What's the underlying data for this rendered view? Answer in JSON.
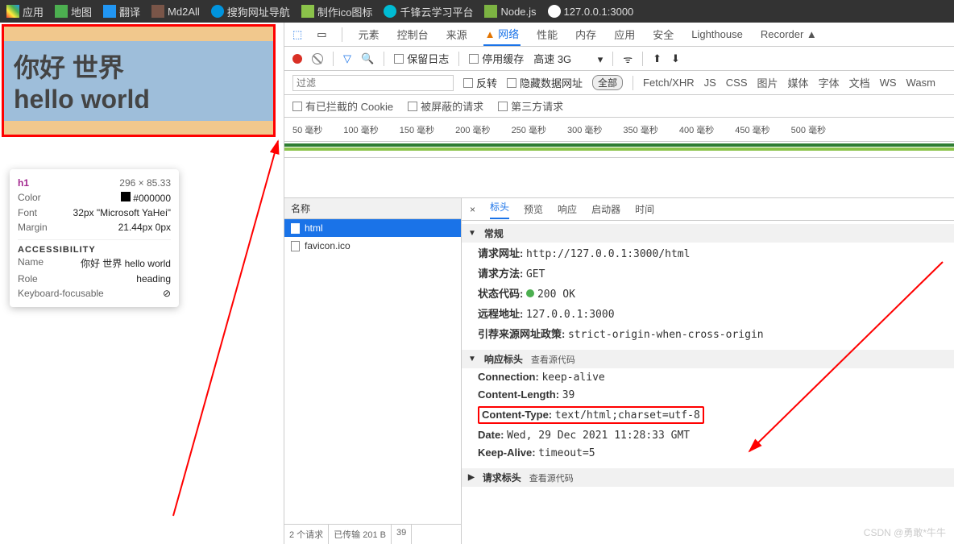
{
  "bookmarks": [
    {
      "label": "应用",
      "color": "#ff5722"
    },
    {
      "label": "地图",
      "color": "#4caf50"
    },
    {
      "label": "翻译",
      "color": "#2196f3"
    },
    {
      "label": "Md2All",
      "color": "#795548"
    },
    {
      "label": "搜狗网址导航",
      "color": "#0094de"
    },
    {
      "label": "制作ico图标",
      "color": "#8bc34a"
    },
    {
      "label": "千锋云学习平台",
      "color": "#00bcd4"
    },
    {
      "label": "Node.js",
      "color": "#7cb342"
    },
    {
      "label": "127.0.0.1:3000",
      "color": "#fff"
    }
  ],
  "page": {
    "line1": "你好 世界",
    "line2": "hello world"
  },
  "tooltip": {
    "tag": "h1",
    "dims": "296 × 85.33",
    "rows": [
      {
        "l": "Color",
        "r": "#000000",
        "sw": true
      },
      {
        "l": "Font",
        "r": "32px \"Microsoft YaHei\""
      },
      {
        "l": "Margin",
        "r": "21.44px 0px"
      }
    ],
    "acc": "ACCESSIBILITY",
    "arows": [
      {
        "l": "Name",
        "r": "你好 世界 hello world"
      },
      {
        "l": "Role",
        "r": "heading"
      },
      {
        "l": "Keyboard-focusable",
        "r": "⊘"
      }
    ]
  },
  "devtabs": [
    "元素",
    "控制台",
    "来源",
    "网络",
    "性能",
    "内存",
    "应用",
    "安全",
    "Lighthouse",
    "Recorder"
  ],
  "devtabs_active": "网络",
  "netbar": {
    "keep": "保留日志",
    "cache": "停用缓存",
    "throttle": "高速 3G"
  },
  "filter": {
    "ph": "过滤",
    "invert": "反转",
    "hide": "隐藏数据网址",
    "all": "全部",
    "types": [
      "Fetch/XHR",
      "JS",
      "CSS",
      "图片",
      "媒体",
      "字体",
      "文档",
      "WS",
      "Wasm"
    ]
  },
  "opts": [
    "有已拦截的 Cookie",
    "被屏蔽的请求",
    "第三方请求"
  ],
  "timeline": [
    "50 毫秒",
    "100 毫秒",
    "150 毫秒",
    "200 毫秒",
    "250 毫秒",
    "300 毫秒",
    "350 毫秒",
    "400 毫秒",
    "450 毫秒",
    "500 毫秒"
  ],
  "reqlist": {
    "header": "名称",
    "items": [
      "html",
      "favicon.ico"
    ],
    "selected": 0,
    "footer": [
      "2 个请求",
      "已传输 201 B",
      "39"
    ]
  },
  "dettabs": [
    "标头",
    "预览",
    "响应",
    "启动器",
    "时间"
  ],
  "dettabs_active": "标头",
  "sections": {
    "general": {
      "title": "常规",
      "kv": [
        {
          "k": "请求网址:",
          "v": "http://127.0.0.1:3000/html"
        },
        {
          "k": "请求方法:",
          "v": "GET"
        },
        {
          "k": "状态代码:",
          "v": "200 OK",
          "status": true
        },
        {
          "k": "远程地址:",
          "v": "127.0.0.1:3000"
        },
        {
          "k": "引荐来源网址政策:",
          "v": "strict-origin-when-cross-origin"
        }
      ]
    },
    "resp": {
      "title": "响应标头",
      "src": "查看源代码",
      "kv": [
        {
          "k": "Connection:",
          "v": "keep-alive"
        },
        {
          "k": "Content-Length:",
          "v": "39"
        },
        {
          "k": "Content-Type:",
          "v": "text/html;charset=utf-8",
          "hl": true
        },
        {
          "k": "Date:",
          "v": "Wed, 29 Dec 2021 11:28:33 GMT"
        },
        {
          "k": "Keep-Alive:",
          "v": "timeout=5"
        }
      ]
    },
    "req": {
      "title": "请求标头",
      "src": "查看源代码"
    }
  },
  "watermark": "CSDN @勇敢*牛牛"
}
